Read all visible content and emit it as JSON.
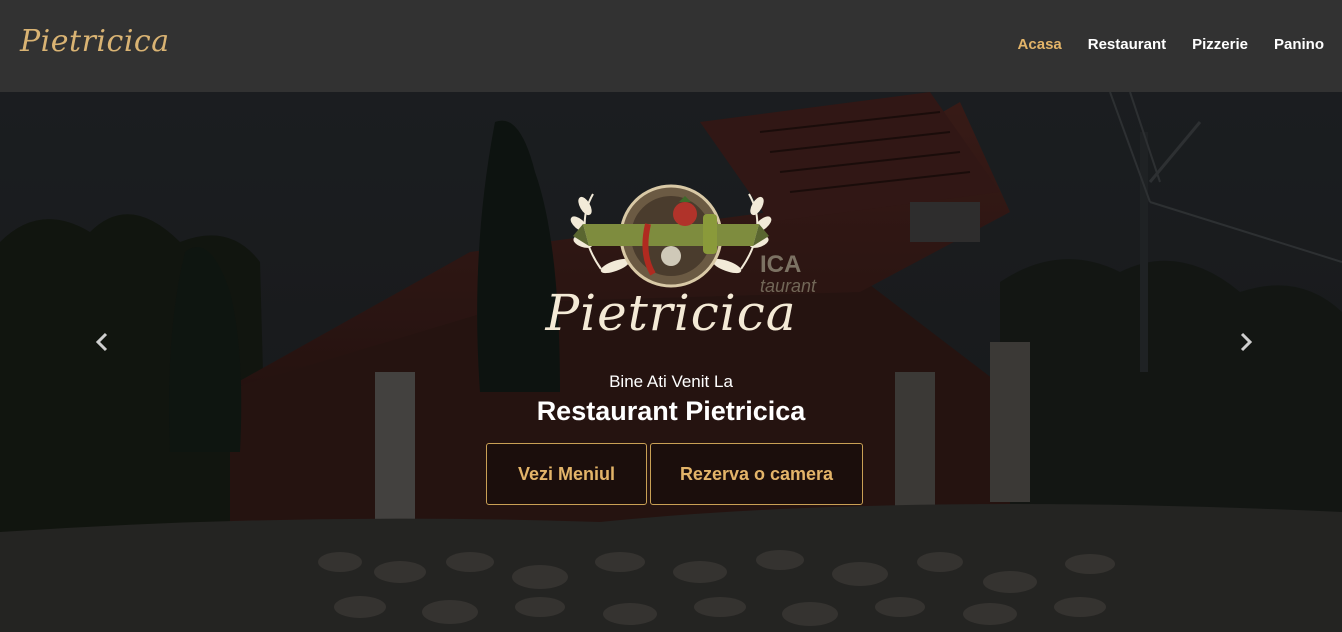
{
  "header": {
    "brand": "Pietricica",
    "nav": [
      "Acasa",
      "Restaurant",
      "Pizzerie",
      "Panino"
    ],
    "active_nav": "Acasa"
  },
  "hero": {
    "logo_text": "Pietricica",
    "welcome": "Bine Ati Venit La",
    "title": "Restaurant Pietricica",
    "buttons": {
      "menu": "Vezi Meniul",
      "booking": "Rezerva o camera"
    },
    "sign_text": "ICA",
    "sign_sub": "taurant",
    "prev_icon": "chevron-left-icon",
    "next_icon": "chevron-right-icon"
  },
  "colors": {
    "header_bg": "#323232",
    "accent": "#e3b469",
    "text": "#ffffff"
  }
}
